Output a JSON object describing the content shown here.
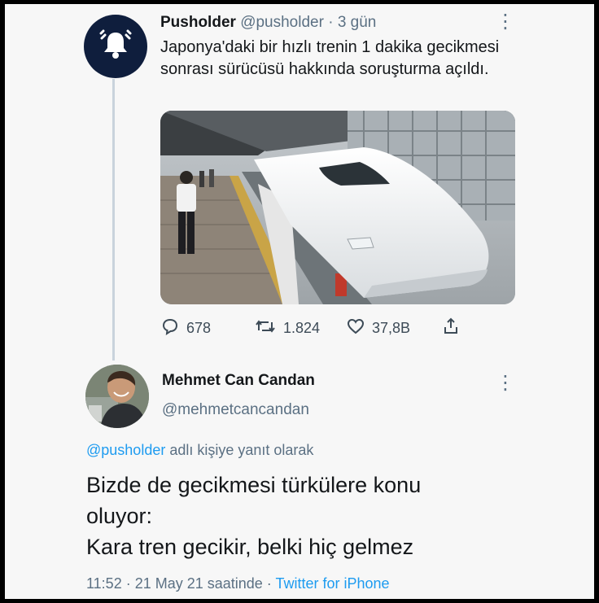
{
  "tweet": {
    "author_name": "Pusholder",
    "handle": "@pusholder",
    "separator": "·",
    "age": "3 gün",
    "text": "Japonya'daki bir hızlı trenin 1 dakika gecikmesi sonrası sürücüsü hakkında soruşturma açıldı.",
    "avatar_icon": "bell-icon",
    "photo": "train-photo",
    "stats": {
      "replies": "678",
      "retweets": "1.824",
      "likes": "37,8B"
    },
    "action_icons": [
      "reply-icon",
      "retweet-icon",
      "like-icon",
      "share-icon"
    ]
  },
  "reply": {
    "author_name": "Mehmet Can Candan",
    "handle": "@mehmetcancandan",
    "context_mention": "@pusholder",
    "context_rest": " adlı kişiye yanıt olarak",
    "text_lines": [
      "Bizde de gecikmesi türkülere konu",
      "oluyor:",
      "Kara tren gecikir, belki hiç gelmez"
    ],
    "time": "11:52 · 21 May 21 saatinde · ",
    "source": "Twitter for iPhone"
  },
  "colors": {
    "background": "#f7f7f7",
    "text": "#14171a",
    "muted": "#5b7083",
    "link": "#1d9bf0",
    "bell_avatar": "#0f1e3d",
    "thread_line": "#c9d3dc"
  }
}
